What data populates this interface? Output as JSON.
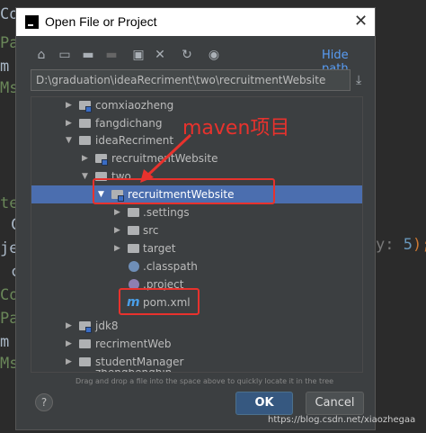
{
  "background": {
    "left_lines": [
      "Co",
      "Pa",
      "m",
      "Ms",
      "",
      "te",
      "C",
      "je",
      "c",
      "Co",
      "Pa",
      "m",
      "Ms"
    ],
    "right_hint_label": "y:",
    "right_hint_value": "5",
    "right_hint_suffix": ");"
  },
  "dialog": {
    "title": "Open File or Project",
    "close_glyph": "✕",
    "toolbar": {
      "hide_path_label": "Hide path"
    },
    "path_value": "D:\\graduation\\ideaRecriment\\two\\recruitmentWebsite",
    "tree": [
      {
        "label": "comxiaozheng",
        "depth": 0,
        "expanded": false,
        "icon": "module-folder-icon"
      },
      {
        "label": "fangdichang",
        "depth": 0,
        "expanded": false,
        "icon": "folder-icon"
      },
      {
        "label": "ideaRecriment",
        "depth": 0,
        "expanded": true,
        "icon": "folder-icon"
      },
      {
        "label": "recruitmentWebsite",
        "depth": 1,
        "expanded": false,
        "icon": "module-folder-icon"
      },
      {
        "label": "two",
        "depth": 1,
        "expanded": true,
        "icon": "folder-icon"
      },
      {
        "label": "recruitmentWebsite",
        "depth": 2,
        "expanded": true,
        "icon": "module-folder-icon",
        "selected": true
      },
      {
        "label": ".settings",
        "depth": 3,
        "expanded": false,
        "icon": "folder-icon"
      },
      {
        "label": "src",
        "depth": 3,
        "expanded": false,
        "icon": "folder-icon"
      },
      {
        "label": "target",
        "depth": 3,
        "expanded": false,
        "icon": "folder-icon"
      },
      {
        "label": ".classpath",
        "depth": 3,
        "leaf": true,
        "icon": "classpath-file-icon"
      },
      {
        "label": ".project",
        "depth": 3,
        "leaf": true,
        "icon": "project-file-icon"
      },
      {
        "label": "pom.xml",
        "depth": 3,
        "leaf": true,
        "icon": "maven-m-icon"
      },
      {
        "label": "jdk8",
        "depth": 0,
        "expanded": false,
        "icon": "module-folder-icon"
      },
      {
        "label": "recrimentWeb",
        "depth": 0,
        "expanded": false,
        "icon": "folder-icon"
      },
      {
        "label": "studentManager",
        "depth": 0,
        "expanded": false,
        "icon": "folder-icon"
      },
      {
        "label": "zhengbenghin",
        "depth": 0,
        "expanded": false,
        "icon": "folder-icon"
      }
    ],
    "hint": "Drag and drop a file into the space above to quickly locate it in the tree",
    "help_label": "?",
    "ok_label": "OK",
    "cancel_label": "Cancel"
  },
  "annotation": {
    "text": "maven项目",
    "color": "#e8322d"
  },
  "watermark": "https://blog.csdn.net/xiaozhegaa"
}
